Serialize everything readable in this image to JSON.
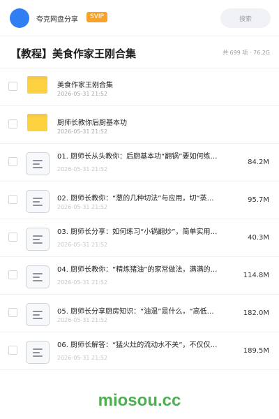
{
  "header": {
    "username": "夸克网盘分享",
    "badge": "SVIP",
    "search_placeholder": "搜索",
    "colors": {
      "avatar": "#2f7ef2",
      "badge": "#f6a22b"
    }
  },
  "folder_title": "【教程】美食作家王刚合集",
  "folder_meta": "共 699 项 · 76.2G",
  "items": [
    {
      "type": "folder",
      "name": "美食作家王刚合集",
      "date": "2026-05-31 21:52",
      "size": ""
    },
    {
      "type": "folder",
      "name": "厨师长教你后厨基本功",
      "date": "2026-05-31 21:52",
      "size": ""
    },
    {
      "type": "file",
      "name": "01. 厨师长从头教你：后厨基本功“翻锅”要如何练…",
      "date": "2026-05-31 21:52",
      "size": "84.2M"
    },
    {
      "type": "file",
      "name": "02. 厨师长教你：“葱的几种切法”与应用，切“蒸…",
      "date": "2026-05-31 21:52",
      "size": "95.7M"
    },
    {
      "type": "file",
      "name": "03. 厨师长分享：如何练习“小锅翻炒”，简单实用…",
      "date": "2026-05-31 21:52",
      "size": "40.3M"
    },
    {
      "type": "file",
      "name": "04. 厨师长教你：“精炼猪油”的家常做法，满满的…",
      "date": "2026-05-31 21:52",
      "size": "114.8M"
    },
    {
      "type": "file",
      "name": "05. 厨师长分享厨房知识：“油温”是什么，“高低…",
      "date": "2026-05-31 21:52",
      "size": "182.0M"
    },
    {
      "type": "file",
      "name": "06. 厨师长解答：“猛火灶的流动水不关”，不仅仅…",
      "date": "2026-05-31 21:52",
      "size": "189.5M"
    }
  ],
  "watermark": "miosou.cc",
  "icons": {
    "folder": "folder-icon",
    "file": "file-icon",
    "checkbox": "checkbox"
  }
}
